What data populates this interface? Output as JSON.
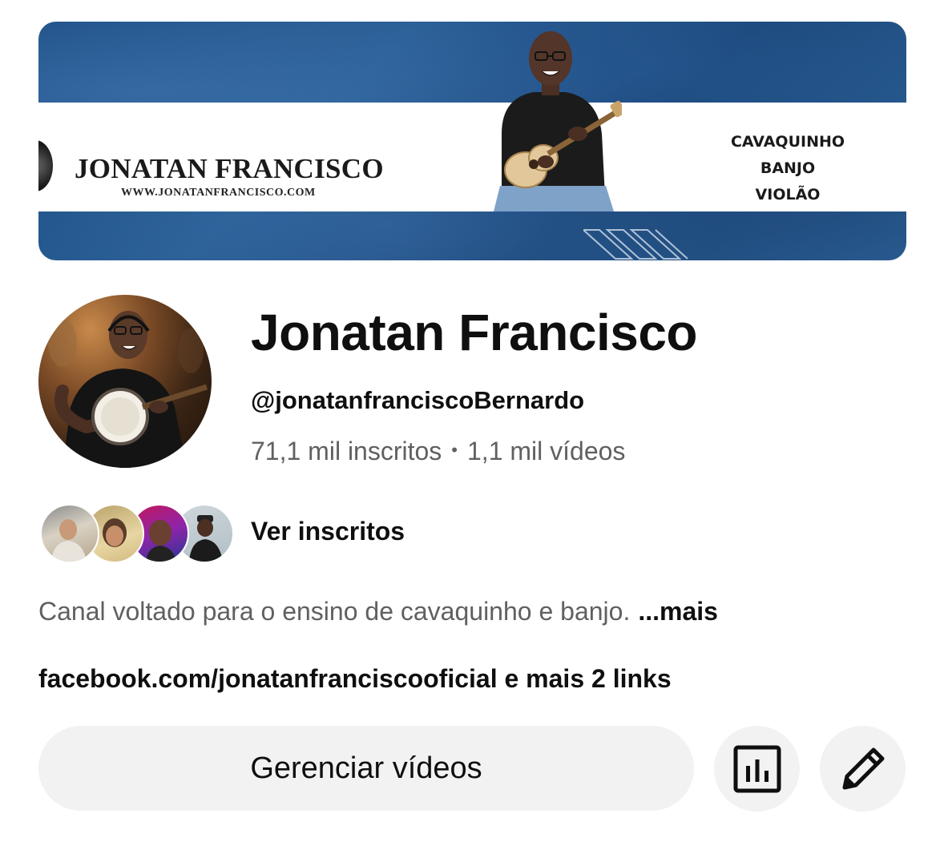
{
  "banner": {
    "name": "JONATAN FRANCISCO",
    "url": "WWW.JONATANFRANCISCO.COM",
    "instruments": [
      "CAVAQUINHO",
      "BANJO",
      "VIOLÃO"
    ],
    "colors": {
      "blue": "#1f5288",
      "strip": "#ffffff"
    }
  },
  "channel": {
    "name": "Jonatan Francisco",
    "handle": "@jonatanfranciscoBernardo",
    "subscribers": "71,1 mil inscritos",
    "separator": "•",
    "videos": "1,1 mil vídeos"
  },
  "subscribers_preview": {
    "label": "Ver inscritos",
    "avatars": [
      "subscriber-avatar",
      "subscriber-avatar",
      "subscriber-avatar",
      "subscriber-avatar"
    ]
  },
  "description": {
    "text": "Canal voltado para o ensino de cavaquinho e banjo.",
    "more": "...mais"
  },
  "links": {
    "text": "facebook.com/jonatanfranciscooficial e mais 2 links"
  },
  "actions": {
    "manage_videos": "Gerenciar vídeos",
    "analytics_icon": "analytics-icon",
    "edit_icon": "pencil-icon"
  },
  "colors": {
    "text_primary": "#0f0f0f",
    "text_secondary": "#606060",
    "button_bg": "#f2f2f2"
  }
}
